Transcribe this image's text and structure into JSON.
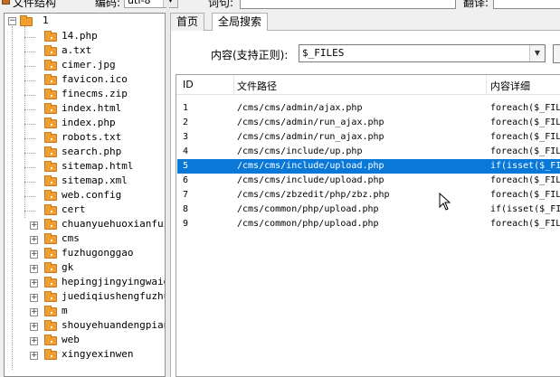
{
  "topbar": {
    "title": "文件结构",
    "encoding_label": "编码:",
    "encoding_value": "utf-8",
    "word_label": "词句:",
    "translate_label": "翻译:"
  },
  "tree": {
    "root": "1",
    "files": [
      "14.php",
      "a.txt",
      "cimer.jpg",
      "favicon.ico",
      "finecms.zip",
      "index.html",
      "index.php",
      "robots.txt",
      "search.php",
      "sitemap.html",
      "sitemap.xml",
      "web.config"
    ],
    "folders": [
      "cert",
      "chuanyuehuoxianfuzh",
      "cms",
      "fuzhugonggao",
      "gk",
      "hepingjingyingwaigu",
      "juediqiushengfuzhuq",
      "m",
      "shouyehuandengpian",
      "web",
      "xingyexinwen"
    ]
  },
  "tabs": [
    "首页",
    "全局搜索"
  ],
  "search": {
    "label": "内容(支持正则):",
    "value": "$_FILES"
  },
  "results": {
    "columns": [
      "ID",
      "文件路径",
      "内容详细"
    ],
    "rows": [
      {
        "id": "1",
        "path": "/cms/cms/admin/ajax.php",
        "detail": "foreach($_FIL"
      },
      {
        "id": "2",
        "path": "/cms/cms/admin/run_ajax.php",
        "detail": "foreach($_FIL"
      },
      {
        "id": "3",
        "path": "/cms/cms/admin/run_ajax.php",
        "detail": "foreach($_FIL"
      },
      {
        "id": "4",
        "path": "/cms/cms/include/up.php",
        "detail": "foreach($_FIL"
      },
      {
        "id": "5",
        "path": "/cms/cms/include/upload.php",
        "detail": "if(isset($_FI"
      },
      {
        "id": "6",
        "path": "/cms/cms/include/upload.php",
        "detail": "foreach($_FIL"
      },
      {
        "id": "7",
        "path": "/cms/cms/zbzedit/php/zbz.php",
        "detail": "foreach($_FIL"
      },
      {
        "id": "8",
        "path": "/cms/common/php/upload.php",
        "detail": "if(isset($_FI"
      },
      {
        "id": "9",
        "path": "/cms/common/php/upload.php",
        "detail": "foreach($_FIL"
      }
    ],
    "selected_index": 4
  },
  "colors": {
    "selection": "#0a78d7",
    "folder": "#f0a030"
  }
}
